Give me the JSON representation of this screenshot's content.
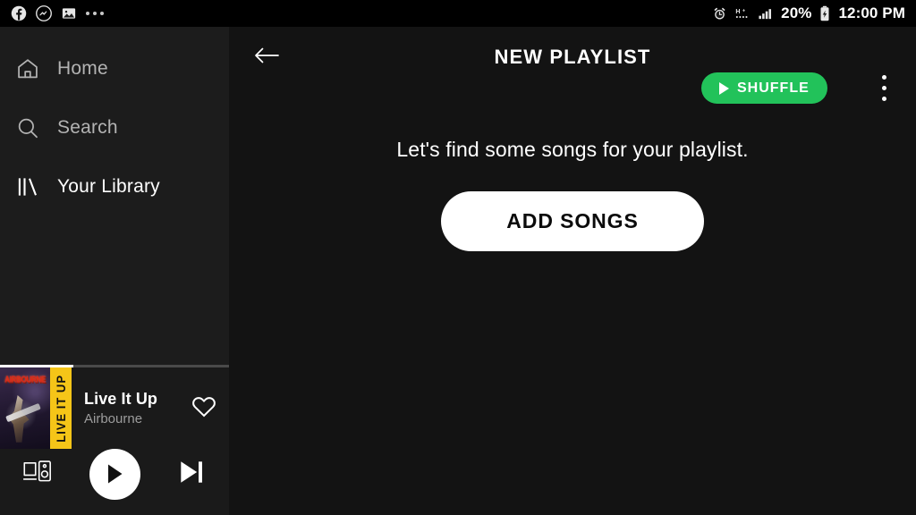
{
  "status_bar": {
    "left_icons": [
      {
        "name": "facebook-icon",
        "label": "Facebook"
      },
      {
        "name": "messenger-icon",
        "label": "Messenger"
      },
      {
        "name": "photo-icon",
        "label": "Photos"
      },
      {
        "name": "more-notifications-icon",
        "label": "More notifications"
      }
    ],
    "right": {
      "alarm_icon": "alarm-icon",
      "network_type": "H+",
      "signal_icon": "signal-bars-icon",
      "battery_percent": "20%",
      "battery_icon": "battery-charging-icon",
      "time": "12:00 PM"
    }
  },
  "sidebar": {
    "items": [
      {
        "label": "Home",
        "icon": "home-icon",
        "active": false
      },
      {
        "label": "Search",
        "icon": "search-icon",
        "active": false
      },
      {
        "label": "Your Library",
        "icon": "library-icon",
        "active": true
      }
    ]
  },
  "now_playing": {
    "title": "Live It Up",
    "artist": "Airbourne",
    "album_art": {
      "artist_logo": "AIRBOURNE",
      "album_band_text": "LIVE IT UP"
    },
    "progress_percent": 32,
    "like_icon": "heart-outline-icon",
    "controls": [
      {
        "name": "connect-device-button",
        "icon": "connect-device-icon"
      },
      {
        "name": "play-button",
        "icon": "play-icon"
      },
      {
        "name": "skip-next-button",
        "icon": "skip-next-icon"
      }
    ]
  },
  "header": {
    "back_icon": "back-arrow-icon",
    "title": "NEW PLAYLIST",
    "shuffle_label": "SHUFFLE",
    "shuffle_icon": "play-icon",
    "overflow_icon": "overflow-menu-icon"
  },
  "main": {
    "empty_message": "Let's find some songs for your playlist.",
    "add_songs_label": "ADD SONGS"
  },
  "colors": {
    "accent_green": "#22c25a",
    "background": "#131313",
    "sidebar_background": "#1c1c1c",
    "text_primary": "#ffffff",
    "text_secondary": "#b3b3b3"
  }
}
